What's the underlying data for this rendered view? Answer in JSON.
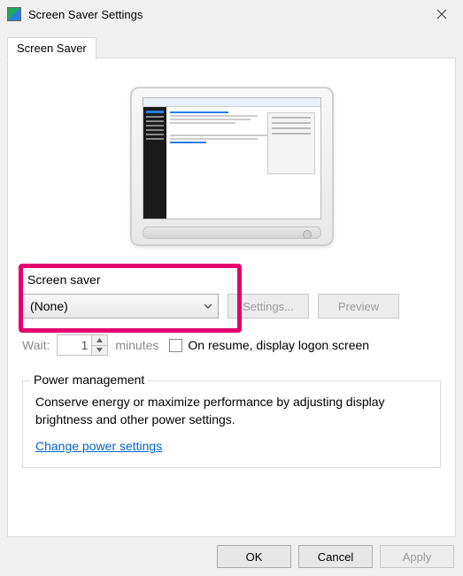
{
  "window": {
    "title": "Screen Saver Settings"
  },
  "tab": {
    "label": "Screen Saver"
  },
  "screensaver": {
    "label": "Screen saver",
    "selected": "(None)",
    "settings_btn": "Settings...",
    "preview_btn": "Preview"
  },
  "wait": {
    "label": "Wait:",
    "value": "1",
    "unit": "minutes",
    "resume_label": "On resume, display logon screen"
  },
  "power": {
    "legend": "Power management",
    "description": "Conserve energy or maximize performance by adjusting display brightness and other power settings.",
    "link": "Change power settings"
  },
  "buttons": {
    "ok": "OK",
    "cancel": "Cancel",
    "apply": "Apply"
  }
}
